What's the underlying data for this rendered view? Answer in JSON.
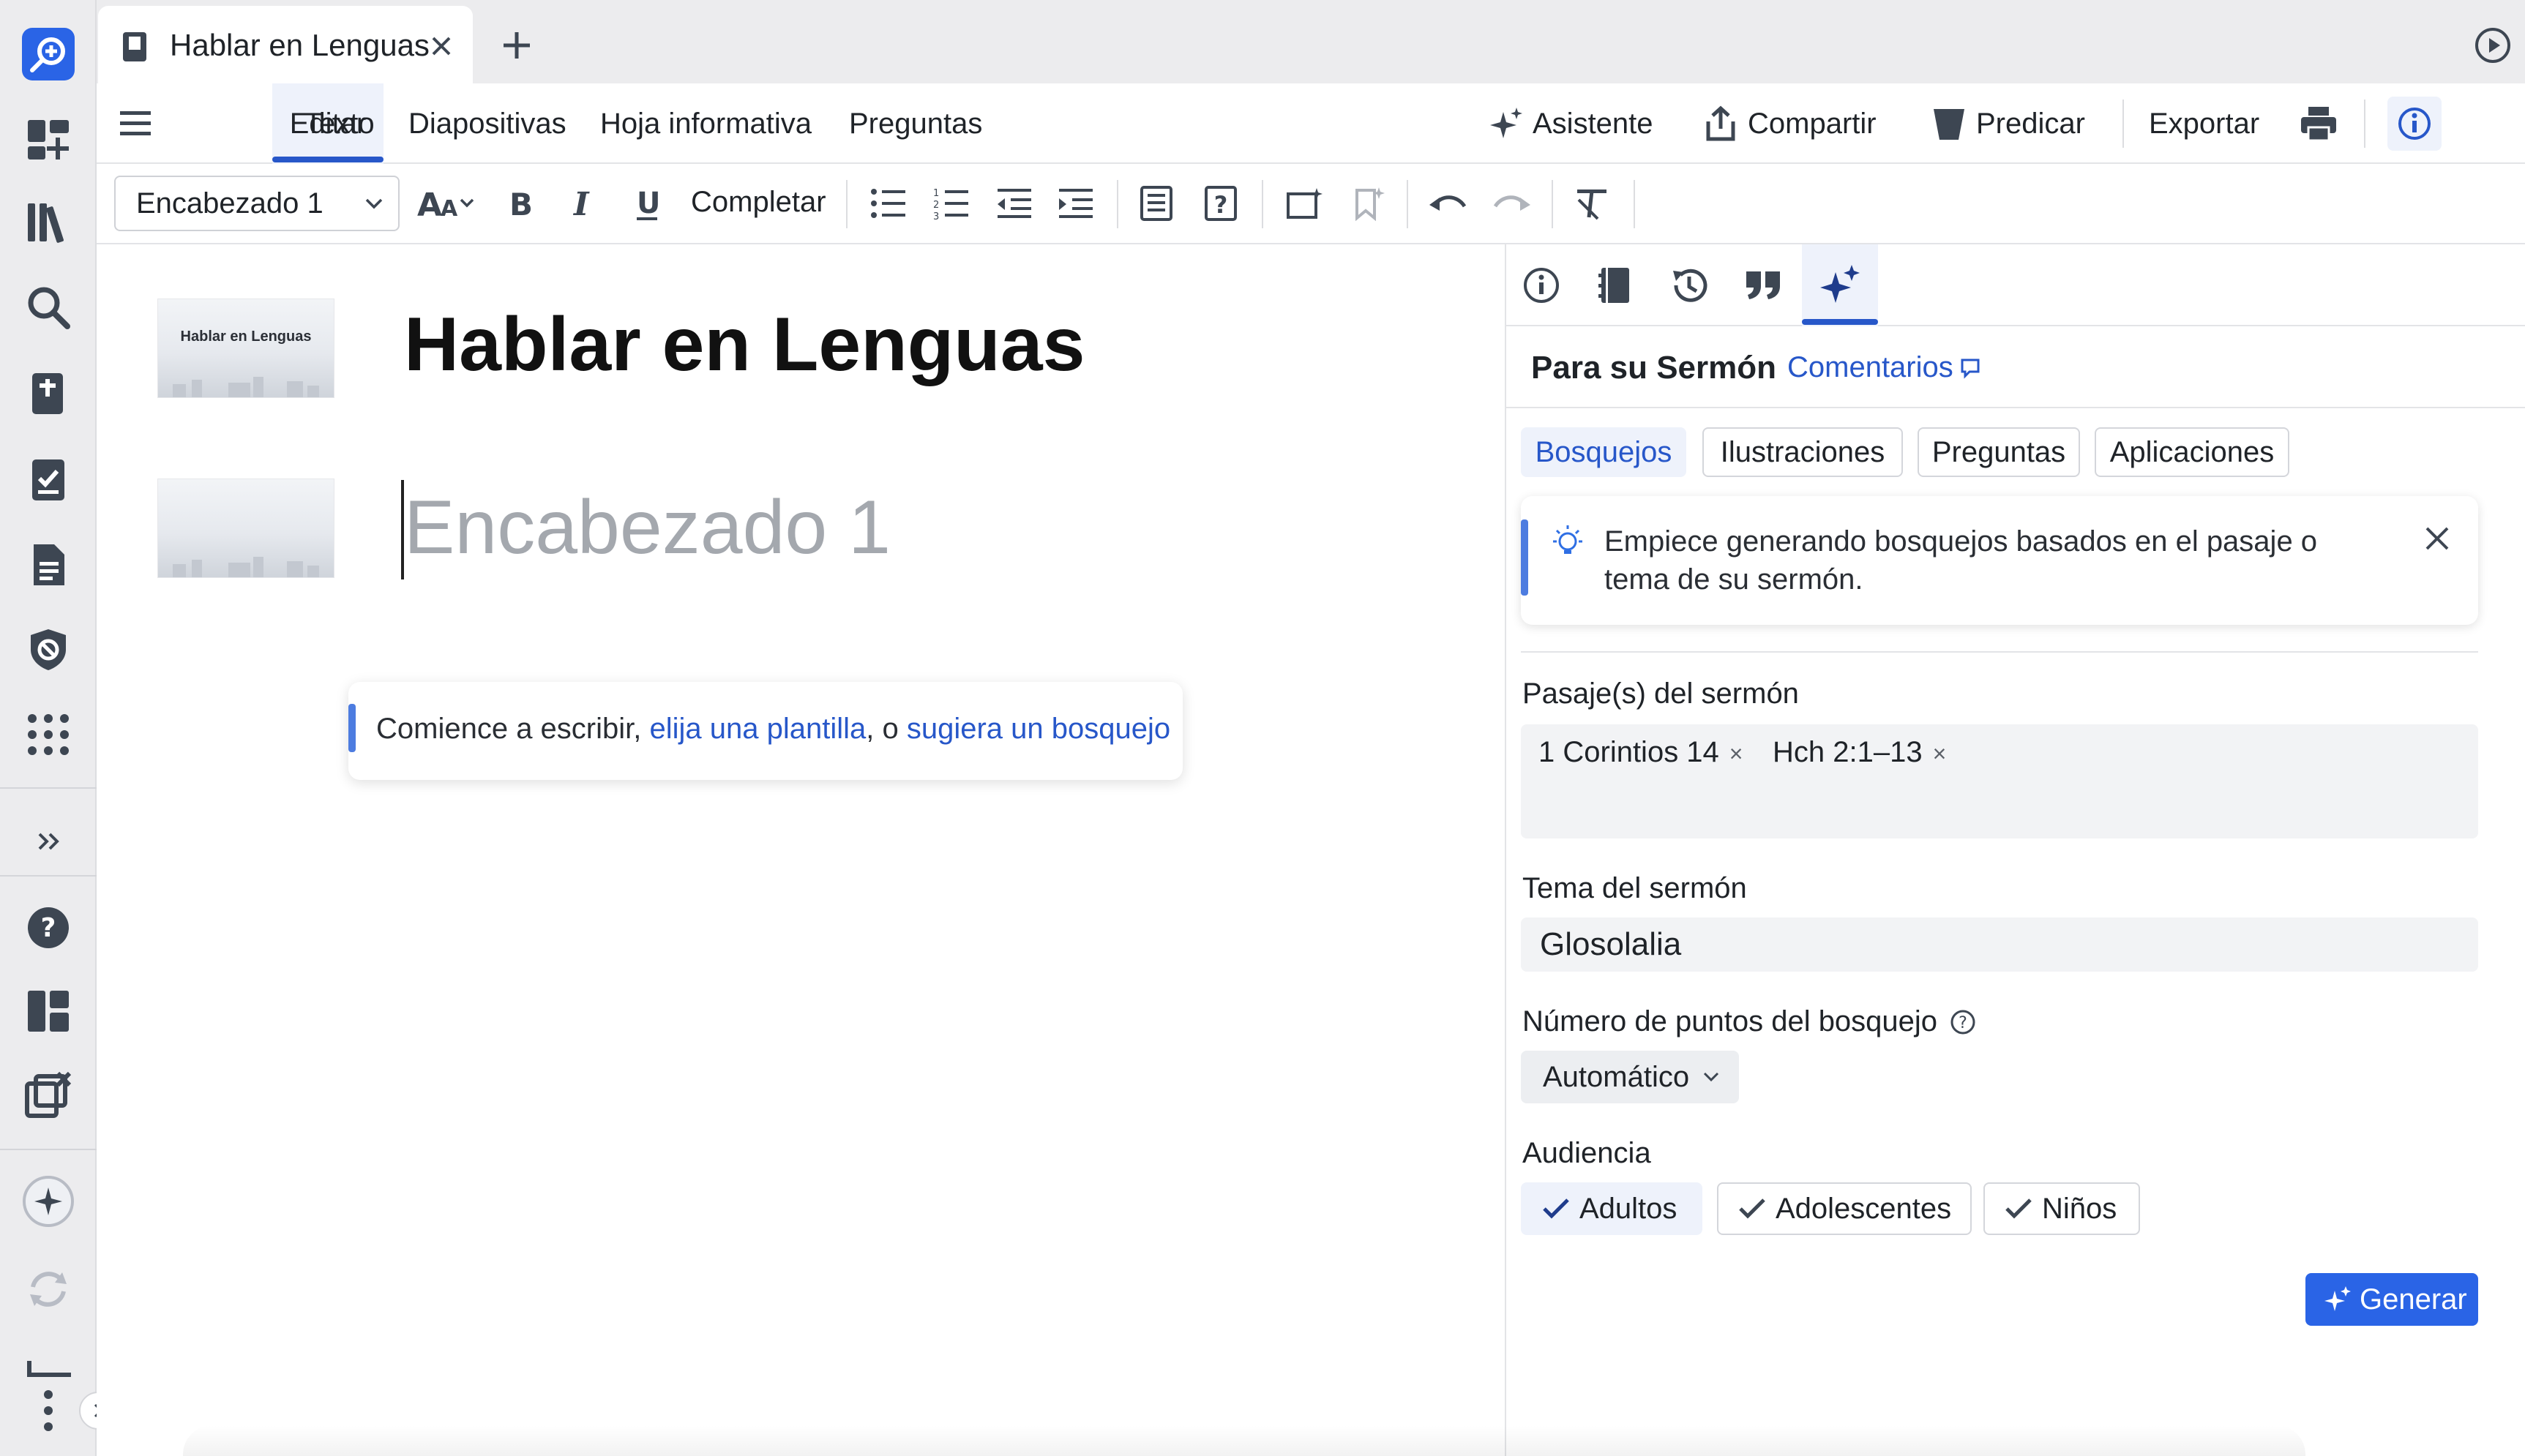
{
  "tab": {
    "title": "Hablar en Lenguas"
  },
  "menu": {
    "items": [
      "Editar",
      "Texto",
      "Diapositivas",
      "Hoja informativa",
      "Preguntas"
    ],
    "asistente": "Asistente",
    "compartir": "Compartir",
    "predicar": "Predicar",
    "exportar": "Exportar"
  },
  "toolbar": {
    "style_select": "Encabezado 1",
    "completar": "Completar"
  },
  "editor": {
    "thumbnail_title": "Hablar en Lenguas",
    "doc_title": "Hablar en Lenguas",
    "heading_placeholder": "Encabezado 1",
    "hint_prefix": "Comience a escribir, ",
    "hint_link1": "elija una plantilla",
    "hint_middle": ", o ",
    "hint_link2": "sugiera un bosquejo"
  },
  "panel": {
    "title": "Para su Sermón",
    "feedback": "Comentarios",
    "subtabs": [
      "Bosquejos",
      "Ilustraciones",
      "Preguntas",
      "Aplicaciones"
    ],
    "tip": "Empiece generando bosquejos basados en el pasaje o tema de su sermón.",
    "passages_label": "Pasaje(s) del sermón",
    "passages": [
      "1 Corintios 14",
      "Hch 2:1–13"
    ],
    "topic_label": "Tema del sermón",
    "topic_value": "Glosolalia",
    "points_label": "Número de puntos del bosquejo",
    "points_value": "Automático",
    "audience_label": "Audiencia",
    "audience": [
      "Adultos",
      "Adolescentes",
      "Niños"
    ],
    "generate": "Generar"
  },
  "colors": {
    "accent": "#2757c9",
    "button": "#2a64e6",
    "rail": "#ececee"
  }
}
